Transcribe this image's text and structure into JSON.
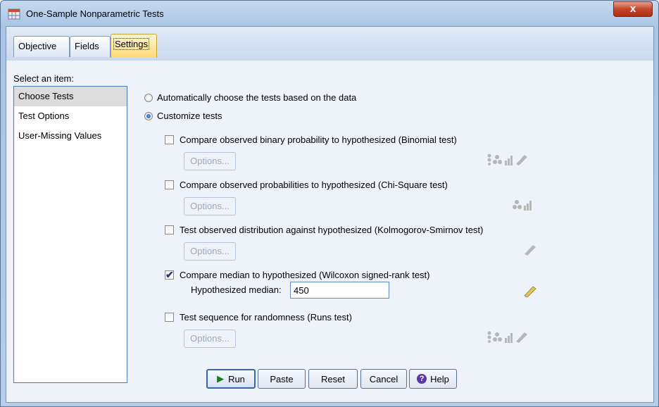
{
  "window": {
    "title": "One-Sample Nonparametric Tests",
    "close_glyph": "x"
  },
  "tabs": [
    {
      "label": "Objective"
    },
    {
      "label": "Fields"
    },
    {
      "label": "Settings"
    }
  ],
  "sidebar": {
    "label": "Select an item:",
    "items": [
      {
        "label": "Choose Tests"
      },
      {
        "label": "Test Options"
      },
      {
        "label": "User-Missing Values"
      }
    ]
  },
  "mode": {
    "auto_label": "Automatically choose the tests based on the data",
    "custom_label": "Customize tests",
    "selected": "custom"
  },
  "tests": {
    "binomial": {
      "label": "Compare observed binary probability to hypothesized (Binomial test)",
      "checked": false,
      "options": "Options..."
    },
    "chisquare": {
      "label": "Compare observed probabilities to hypothesized (Chi-Square test)",
      "checked": false,
      "options": "Options..."
    },
    "ks": {
      "label": "Test observed distribution against hypothesized (Kolmogorov-Smirnov test)",
      "checked": false,
      "options": "Options..."
    },
    "wilcoxon": {
      "label": "Compare median to hypothesized (Wilcoxon signed-rank test)",
      "checked": true,
      "median_label": "Hypothesized median:",
      "median_value": "450"
    },
    "runs": {
      "label": "Test sequence for randomness (Runs test)",
      "checked": false,
      "options": "Options..."
    }
  },
  "buttons": {
    "run": "Run",
    "paste": "Paste",
    "reset": "Reset",
    "cancel": "Cancel",
    "help": "Help"
  },
  "colors": {
    "accent": "#ffd977",
    "selection": "#dcdcdc",
    "frame": "#b7cde8"
  }
}
